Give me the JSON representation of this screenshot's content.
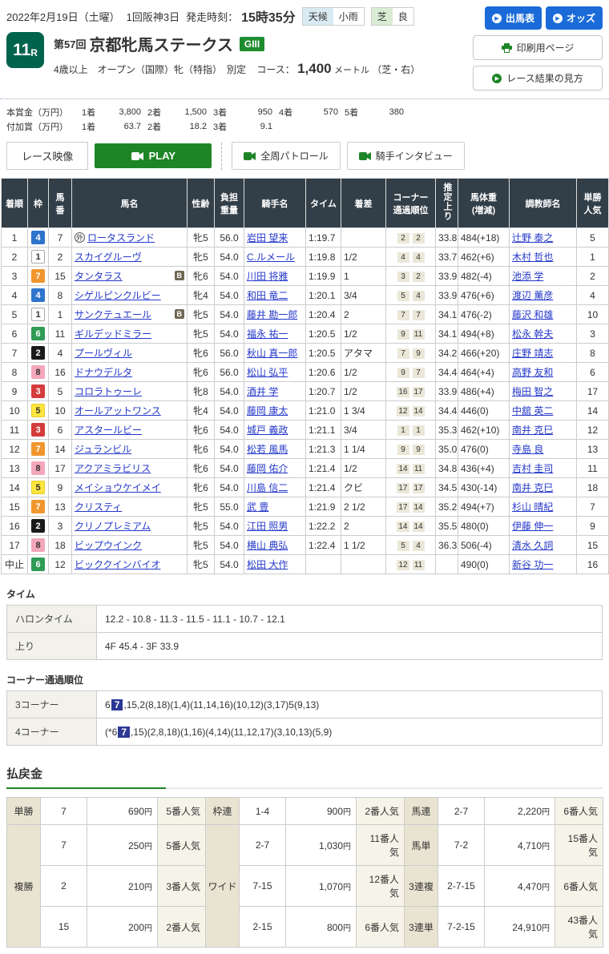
{
  "colors": {
    "accent_blue": "#1a6bd8",
    "accent_green": "#1e8527",
    "table_header_bg": "#333f48",
    "race_badge_bg": "#00634d",
    "link_blue": "#2438c9",
    "corner_win_bg": "#2c3896",
    "payout_label_bg": "#e9e4d2"
  },
  "waku_colors": {
    "1": {
      "bg": "#ffffff",
      "fg": "#333333",
      "bd": "#aaaaaa"
    },
    "2": {
      "bg": "#1a1a1a",
      "fg": "#ffffff",
      "bd": "#1a1a1a"
    },
    "3": {
      "bg": "#d43c3c",
      "fg": "#ffffff",
      "bd": "#d43c3c"
    },
    "4": {
      "bg": "#2c74cc",
      "fg": "#ffffff",
      "bd": "#2c74cc"
    },
    "5": {
      "bg": "#ffe53e",
      "fg": "#333333",
      "bd": "#e3cc30"
    },
    "6": {
      "bg": "#2f9b55",
      "fg": "#ffffff",
      "bd": "#2f9b55"
    },
    "7": {
      "bg": "#f0962e",
      "fg": "#ffffff",
      "bd": "#f0962e"
    },
    "8": {
      "bg": "#f4a7ba",
      "fg": "#333333",
      "bd": "#f4a7ba"
    }
  },
  "header": {
    "date": "2022年2月19日（土曜）",
    "meeting": "1回阪神3日",
    "start_label": "発走時刻：",
    "start_time": "15時35分",
    "weather_label": "天候",
    "weather_value": "小雨",
    "turf_label": "芝",
    "turf_value": "良",
    "buttons": {
      "entries": "出馬表",
      "odds": "オッズ",
      "print": "印刷用ページ",
      "guide": "レース結果の見方"
    }
  },
  "race": {
    "no": "11",
    "no_suffix": "R",
    "kai": "第57回",
    "name": "京都牝馬ステークス",
    "grade": "GIII",
    "conditions": "4歳以上　オープン（国際）牝（特指）　別定",
    "course_label": "コース：",
    "course_value": "1,400",
    "course_unit": "メートル",
    "course_note": "（芝・右）"
  },
  "prize": {
    "main_label": "本賞金（万円）",
    "main": [
      {
        "rank": "1着",
        "value": "3,800"
      },
      {
        "rank": "2着",
        "value": "1,500"
      },
      {
        "rank": "3着",
        "value": "950"
      },
      {
        "rank": "4着",
        "value": "570"
      },
      {
        "rank": "5着",
        "value": "380"
      }
    ],
    "fuka_label": "付加賞（万円）",
    "fuka": [
      {
        "rank": "1着",
        "value": "63.7"
      },
      {
        "rank": "2着",
        "value": "18.2"
      },
      {
        "rank": "3着",
        "value": "9.1"
      }
    ]
  },
  "video": {
    "label": "レース映像",
    "play": "PLAY",
    "patrol": "全周パトロール",
    "interview": "騎手インタビュー"
  },
  "results": {
    "headers": [
      {
        "lines": [
          "着順"
        ]
      },
      {
        "lines": [
          "枠"
        ]
      },
      {
        "lines": [
          "馬",
          "番"
        ]
      },
      {
        "lines": [
          "馬名"
        ]
      },
      {
        "lines": [
          "性齢"
        ]
      },
      {
        "lines": [
          "負担",
          "重量"
        ]
      },
      {
        "lines": [
          "騎手名"
        ]
      },
      {
        "lines": [
          "タイム"
        ]
      },
      {
        "lines": [
          "着差"
        ]
      },
      {
        "lines": [
          "コーナー",
          "通過順位"
        ]
      },
      {
        "lines": [
          "推定上り"
        ],
        "vertical": true
      },
      {
        "lines": [
          "馬体重",
          "(増減)"
        ]
      },
      {
        "lines": [
          "調教師名"
        ]
      },
      {
        "lines": [
          "単勝",
          "人気"
        ]
      }
    ],
    "rows": [
      {
        "pos": "1",
        "waku": "4",
        "num": "7",
        "mark": "外",
        "name": "ロータスランド",
        "b": false,
        "sa": "牝5",
        "wt": "56.0",
        "jockey": "岩田 望来",
        "time": "1:19.7",
        "margin": "",
        "c3": "2",
        "c4": "2",
        "agari": "33.8",
        "hw": "484(+18)",
        "trainer": "辻野 泰之",
        "pop": "5"
      },
      {
        "pos": "2",
        "waku": "1",
        "num": "2",
        "name": "スカイグルーヴ",
        "b": false,
        "sa": "牝5",
        "wt": "54.0",
        "jockey": "C.ルメール",
        "time": "1:19.8",
        "margin": "1/2",
        "c3": "4",
        "c4": "4",
        "agari": "33.7",
        "hw": "462(+6)",
        "trainer": "木村 哲也",
        "pop": "1"
      },
      {
        "pos": "3",
        "waku": "7",
        "num": "15",
        "name": "タンタラス",
        "b": true,
        "sa": "牝6",
        "wt": "54.0",
        "jockey": "川田 将雅",
        "time": "1:19.9",
        "margin": "1",
        "c3": "3",
        "c4": "2",
        "agari": "33.9",
        "hw": "482(-4)",
        "trainer": "池添 学",
        "pop": "2"
      },
      {
        "pos": "4",
        "waku": "4",
        "num": "8",
        "name": "シゲルピンクルビー",
        "b": false,
        "sa": "牝4",
        "wt": "54.0",
        "jockey": "和田 竜二",
        "time": "1:20.1",
        "margin": "3/4",
        "c3": "5",
        "c4": "4",
        "agari": "33.9",
        "hw": "476(+6)",
        "trainer": "渡辺 薫彦",
        "pop": "4"
      },
      {
        "pos": "5",
        "waku": "1",
        "num": "1",
        "name": "サンクテュエール",
        "b": true,
        "sa": "牝5",
        "wt": "54.0",
        "jockey": "藤井 勘一郎",
        "time": "1:20.4",
        "margin": "2",
        "c3": "7",
        "c4": "7",
        "agari": "34.1",
        "hw": "476(-2)",
        "trainer": "藤沢 和雄",
        "pop": "10"
      },
      {
        "pos": "6",
        "waku": "6",
        "num": "11",
        "name": "ギルデッドミラー",
        "b": false,
        "sa": "牝5",
        "wt": "54.0",
        "jockey": "福永 祐一",
        "time": "1:20.5",
        "margin": "1/2",
        "c3": "9",
        "c4": "11",
        "agari": "34.1",
        "hw": "494(+8)",
        "trainer": "松永 幹夫",
        "pop": "3"
      },
      {
        "pos": "7",
        "waku": "2",
        "num": "4",
        "name": "プールヴィル",
        "b": false,
        "sa": "牝6",
        "wt": "56.0",
        "jockey": "秋山 真一郎",
        "time": "1:20.5",
        "margin": "アタマ",
        "c3": "7",
        "c4": "9",
        "agari": "34.2",
        "hw": "466(+20)",
        "trainer": "庄野 靖志",
        "pop": "8"
      },
      {
        "pos": "8",
        "waku": "8",
        "num": "16",
        "name": "ドナウデルタ",
        "b": false,
        "sa": "牝6",
        "wt": "56.0",
        "jockey": "松山 弘平",
        "time": "1:20.6",
        "margin": "1/2",
        "c3": "9",
        "c4": "7",
        "agari": "34.4",
        "hw": "464(+4)",
        "trainer": "高野 友和",
        "pop": "6"
      },
      {
        "pos": "9",
        "waku": "3",
        "num": "5",
        "name": "コロラトゥーレ",
        "b": false,
        "sa": "牝8",
        "wt": "54.0",
        "jockey": "酒井 学",
        "time": "1:20.7",
        "margin": "1/2",
        "c3": "16",
        "c4": "17",
        "agari": "33.9",
        "hw": "486(+4)",
        "trainer": "梅田 智之",
        "pop": "17"
      },
      {
        "pos": "10",
        "waku": "5",
        "num": "10",
        "name": "オールアットワンス",
        "b": false,
        "sa": "牝4",
        "wt": "54.0",
        "jockey": "藤岡 康太",
        "time": "1:21.0",
        "margin": "1 3/4",
        "c3": "12",
        "c4": "14",
        "agari": "34.4",
        "hw": "446(0)",
        "trainer": "中舘 英二",
        "pop": "14"
      },
      {
        "pos": "11",
        "waku": "3",
        "num": "6",
        "name": "アスタールビー",
        "b": false,
        "sa": "牝6",
        "wt": "54.0",
        "jockey": "城戸 義政",
        "time": "1:21.1",
        "margin": "3/4",
        "c3": "1",
        "c4": "1",
        "agari": "35.3",
        "hw": "462(+10)",
        "trainer": "南井 克巳",
        "pop": "12"
      },
      {
        "pos": "12",
        "waku": "7",
        "num": "14",
        "name": "ジュランビル",
        "b": false,
        "sa": "牝6",
        "wt": "54.0",
        "jockey": "松若 風馬",
        "time": "1:21.3",
        "margin": "1 1/4",
        "c3": "9",
        "c4": "9",
        "agari": "35.0",
        "hw": "476(0)",
        "trainer": "寺島 良",
        "pop": "13"
      },
      {
        "pos": "13",
        "waku": "8",
        "num": "17",
        "name": "アクアミラビリス",
        "b": false,
        "sa": "牝6",
        "wt": "54.0",
        "jockey": "藤岡 佑介",
        "time": "1:21.4",
        "margin": "1/2",
        "c3": "14",
        "c4": "11",
        "agari": "34.8",
        "hw": "436(+4)",
        "trainer": "吉村 圭司",
        "pop": "11"
      },
      {
        "pos": "14",
        "waku": "5",
        "num": "9",
        "name": "メイショウケイメイ",
        "b": false,
        "sa": "牝6",
        "wt": "54.0",
        "jockey": "川島 信二",
        "time": "1:21.4",
        "margin": "クビ",
        "c3": "17",
        "c4": "17",
        "agari": "34.5",
        "hw": "430(-14)",
        "trainer": "南井 克巳",
        "pop": "18"
      },
      {
        "pos": "15",
        "waku": "7",
        "num": "13",
        "name": "クリスティ",
        "b": false,
        "sa": "牝5",
        "wt": "55.0",
        "jockey": "武 豊",
        "time": "1:21.9",
        "margin": "2 1/2",
        "c3": "17",
        "c4": "14",
        "agari": "35.2",
        "hw": "494(+7)",
        "trainer": "杉山 晴紀",
        "pop": "7"
      },
      {
        "pos": "16",
        "waku": "2",
        "num": "3",
        "name": "クリノプレミアム",
        "b": false,
        "sa": "牝5",
        "wt": "54.0",
        "jockey": "江田 照男",
        "time": "1:22.2",
        "margin": "2",
        "c3": "14",
        "c4": "14",
        "agari": "35.5",
        "hw": "480(0)",
        "trainer": "伊藤 伸一",
        "pop": "9"
      },
      {
        "pos": "17",
        "waku": "8",
        "num": "18",
        "name": "ビップウインク",
        "b": false,
        "sa": "牝5",
        "wt": "54.0",
        "jockey": "横山 典弘",
        "time": "1:22.4",
        "margin": "1 1/2",
        "c3": "5",
        "c4": "4",
        "agari": "36.3",
        "hw": "506(-4)",
        "trainer": "清水 久詞",
        "pop": "15"
      },
      {
        "pos": "中止",
        "waku": "6",
        "num": "12",
        "name": "ビッククインバイオ",
        "b": false,
        "sa": "牝5",
        "wt": "54.0",
        "jockey": "松田 大作",
        "time": "",
        "margin": "",
        "c3": "12",
        "c4": "11",
        "agari": "",
        "hw": "490(0)",
        "trainer": "新谷 功一",
        "pop": "16"
      }
    ]
  },
  "time_section": {
    "title": "タイム",
    "rows": [
      {
        "label": "ハロンタイム",
        "value": "12.2 - 10.8 - 11.3 - 11.5 - 11.1 - 10.7 - 12.1"
      },
      {
        "label": "上り",
        "value": "4F 45.4 - 3F 33.9"
      }
    ]
  },
  "corner_section": {
    "title": "コーナー通過順位",
    "rows": [
      {
        "label": "3コーナー",
        "pre": "6",
        "win": "7",
        "post": ",15,2(8,18)(1,4)(11,14,16)(10,12)(3,17)5(9,13)"
      },
      {
        "label": "4コーナー",
        "pre": "(*6",
        "win": "7",
        "post": ",15)(2,8,18)(1,16)(4,14)(11,12,17)(3,10,13)(5,9)"
      }
    ]
  },
  "payout": {
    "title": "払戻金",
    "yen": "円",
    "ninki_suffix": "番人気",
    "groups": [
      {
        "rows": [
          {
            "label": "単勝",
            "span": 1,
            "num": "7",
            "amount": "690",
            "pop": "5"
          },
          {
            "label": "複勝",
            "span": 3,
            "num": "7",
            "amount": "250",
            "pop": "5"
          },
          {
            "num": "2",
            "amount": "210",
            "pop": "3",
            "dashed": true
          },
          {
            "num": "15",
            "amount": "200",
            "pop": "2",
            "dashed": true
          }
        ]
      },
      {
        "rows": [
          {
            "label": "枠連",
            "span": 1,
            "num": "1-4",
            "amount": "900",
            "pop": "2"
          },
          {
            "label": "ワイド",
            "span": 3,
            "num": "2-7",
            "amount": "1,030",
            "pop": "11"
          },
          {
            "num": "7-15",
            "amount": "1,070",
            "pop": "12",
            "dashed": true
          },
          {
            "num": "2-15",
            "amount": "800",
            "pop": "6",
            "dashed": true
          }
        ]
      },
      {
        "rows": [
          {
            "label": "馬連",
            "span": 1,
            "num": "2-7",
            "amount": "2,220",
            "pop": "6"
          },
          {
            "label": "馬単",
            "span": 1,
            "num": "7-2",
            "amount": "4,710",
            "pop": "15"
          },
          {
            "label": "3連複",
            "span": 1,
            "num": "2-7-15",
            "amount": "4,470",
            "pop": "6"
          },
          {
            "label": "3連単",
            "span": 1,
            "num": "7-2-15",
            "amount": "24,910",
            "pop": "43"
          }
        ]
      }
    ]
  }
}
